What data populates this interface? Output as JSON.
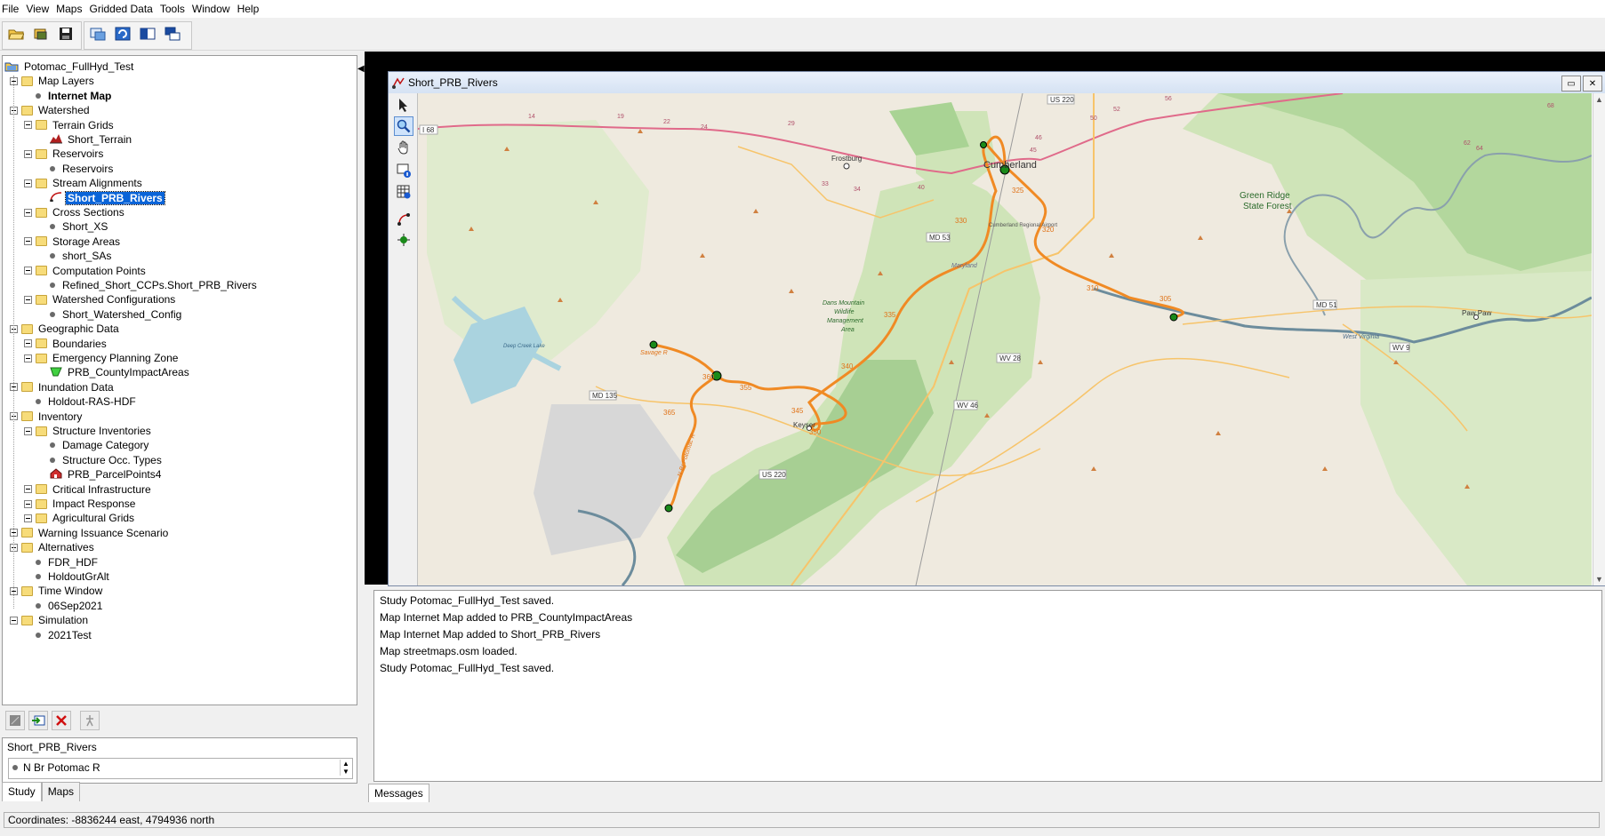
{
  "menu": [
    "File",
    "View",
    "Maps",
    "Gridded Data",
    "Tools",
    "Window",
    "Help"
  ],
  "tree": {
    "root": "Potomac_FullHyd_Test",
    "nodes": [
      {
        "label": "Map Layers",
        "level": 1,
        "kind": "folder"
      },
      {
        "label": "Internet Map",
        "level": 2,
        "kind": "bullet",
        "bold": true
      },
      {
        "label": "Watershed",
        "level": 1,
        "kind": "folder"
      },
      {
        "label": "Terrain Grids",
        "level": 2,
        "kind": "folder"
      },
      {
        "label": "Short_Terrain",
        "level": 3,
        "kind": "terrain"
      },
      {
        "label": "Reservoirs",
        "level": 2,
        "kind": "folder"
      },
      {
        "label": "Reservoirs",
        "level": 3,
        "kind": "bullet"
      },
      {
        "label": "Stream Alignments",
        "level": 2,
        "kind": "folder"
      },
      {
        "label": "Short_PRB_Rivers",
        "level": 3,
        "kind": "stream",
        "selected": true
      },
      {
        "label": "Cross Sections",
        "level": 2,
        "kind": "folder"
      },
      {
        "label": "Short_XS",
        "level": 3,
        "kind": "bullet"
      },
      {
        "label": "Storage Areas",
        "level": 2,
        "kind": "folder"
      },
      {
        "label": "short_SAs",
        "level": 3,
        "kind": "bullet"
      },
      {
        "label": "Computation Points",
        "level": 2,
        "kind": "folder"
      },
      {
        "label": "Refined_Short_CCPs.Short_PRB_Rivers",
        "level": 3,
        "kind": "bullet"
      },
      {
        "label": "Watershed Configurations",
        "level": 2,
        "kind": "folder"
      },
      {
        "label": "Short_Watershed_Config",
        "level": 3,
        "kind": "bullet"
      },
      {
        "label": "Geographic Data",
        "level": 1,
        "kind": "folder"
      },
      {
        "label": "Boundaries",
        "level": 2,
        "kind": "folder"
      },
      {
        "label": "Emergency Planning Zone",
        "level": 2,
        "kind": "folder"
      },
      {
        "label": "PRB_CountyImpactAreas",
        "level": 3,
        "kind": "polygon"
      },
      {
        "label": "Inundation Data",
        "level": 1,
        "kind": "folder"
      },
      {
        "label": "Holdout-RAS-HDF",
        "level": 2,
        "kind": "bullet"
      },
      {
        "label": "Inventory",
        "level": 1,
        "kind": "folder"
      },
      {
        "label": "Structure Inventories",
        "level": 2,
        "kind": "folder"
      },
      {
        "label": "Damage Category",
        "level": 3,
        "kind": "bullet"
      },
      {
        "label": "Structure Occ. Types",
        "level": 3,
        "kind": "bullet"
      },
      {
        "label": "PRB_ParcelPoints4",
        "level": 3,
        "kind": "house"
      },
      {
        "label": "Critical Infrastructure",
        "level": 2,
        "kind": "folder"
      },
      {
        "label": "Impact Response",
        "level": 2,
        "kind": "folder"
      },
      {
        "label": "Agricultural Grids",
        "level": 2,
        "kind": "folder"
      },
      {
        "label": "Warning Issuance Scenario",
        "level": 1,
        "kind": "folder"
      },
      {
        "label": "Alternatives",
        "level": 1,
        "kind": "folder"
      },
      {
        "label": "FDR_HDF",
        "level": 2,
        "kind": "bullet"
      },
      {
        "label": "HoldoutGrAlt",
        "level": 2,
        "kind": "bullet"
      },
      {
        "label": "Time Window",
        "level": 1,
        "kind": "folder"
      },
      {
        "label": "06Sep2021",
        "level": 2,
        "kind": "bullet"
      },
      {
        "label": "Simulation",
        "level": 1,
        "kind": "folder"
      },
      {
        "label": "2021Test",
        "level": 2,
        "kind": "bullet"
      }
    ]
  },
  "info": {
    "title": "Short_PRB_Rivers",
    "item": "N Br Potomac R"
  },
  "left_tabs": [
    "Study",
    "Maps"
  ],
  "map_window": {
    "title": "Short_PRB_Rivers"
  },
  "map_labels": {
    "cumberland": "Cumberland",
    "frostburg": "Frostburg",
    "green_ridge": "Green Ridge",
    "state_forest": "State Forest",
    "paw_paw": "Paw Paw",
    "keyser": "Keyser",
    "dans_mountain": "Dans Mountain",
    "wildlife": "Wildlife",
    "management": "Management",
    "area": "Area",
    "savage_r": "Savage R",
    "n_br_potomac": "N Br Potomac R",
    "maryland": "Maryland",
    "west_virginia": "West Virginia",
    "deep_creek": "Deep Creek Lake",
    "airport": "Cumberland Regional Airport",
    "i68": "I 68",
    "us220_top": "US 220",
    "us220_bottom": "US 220",
    "md53": "MD 53",
    "md135": "MD 135",
    "md51": "MD 51",
    "wv28": "WV 28",
    "wv46": "WV 46",
    "wv9": "WV 9",
    "rm_325": "325",
    "rm_320": "320",
    "rm_310": "310",
    "rm_305": "305",
    "rm_330": "330",
    "rm_340": "340",
    "rm_345": "345",
    "rm_350": "350",
    "rm_355": "355",
    "rm_360": "360",
    "rm_365": "365",
    "rm_335": "335",
    "exit_40": "40",
    "exit_34": "34",
    "exit_33": "33",
    "exit_29": "29",
    "exit_24": "24",
    "exit_22": "22",
    "exit_19": "19",
    "exit_14": "14",
    "exit_45": "45",
    "exit_46": "46",
    "exit_50": "50",
    "exit_52": "52",
    "exit_56": "56",
    "exit_62": "62",
    "exit_64": "64",
    "exit_68": "68"
  },
  "messages": [
    "Study Potomac_FullHyd_Test saved.",
    "Map Internet Map added to PRB_CountyImpactAreas",
    "Map Internet Map added to Short_PRB_Rivers",
    "Map streetmaps.osm loaded.",
    "Study Potomac_FullHyd_Test saved."
  ],
  "messages_tab": "Messages",
  "status": "Coordinates: -8836244 east, 4794936 north",
  "colors": {
    "river": "#f08a24",
    "node": "#1a8a1a",
    "selection": "#0a64d8",
    "forest": "#c8dfb0",
    "water": "#aad3df"
  }
}
